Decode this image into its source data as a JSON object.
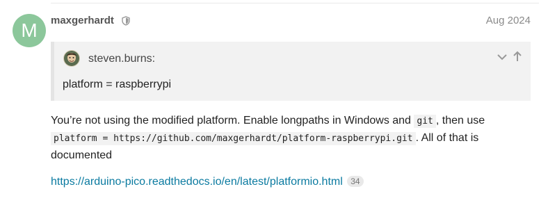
{
  "post": {
    "avatar_letter": "M",
    "avatar_color": "#8cc79b",
    "username": "maxgerhardt",
    "username_icon": "shield-icon",
    "date": "Aug 2024",
    "quote": {
      "author": "steven.burns:",
      "author_avatar": "avatar-image",
      "text": "platform = raspberrypi",
      "expand_icon": "chevron-down-icon",
      "jump_icon": "arrow-up-icon"
    },
    "body": {
      "part1": "You’re not using the modified platform. Enable longpaths in Windows and ",
      "code1": "git",
      "part2": ", then use ",
      "code2": "platform = https://github.com/maxgerhardt/platform-raspberrypi.git",
      "part3": ". All of that is documented"
    },
    "link": {
      "text": "https://arduino-pico.readthedocs.io/en/latest/platformio.html",
      "clicks": "34",
      "color": "#0a7aa0"
    }
  }
}
